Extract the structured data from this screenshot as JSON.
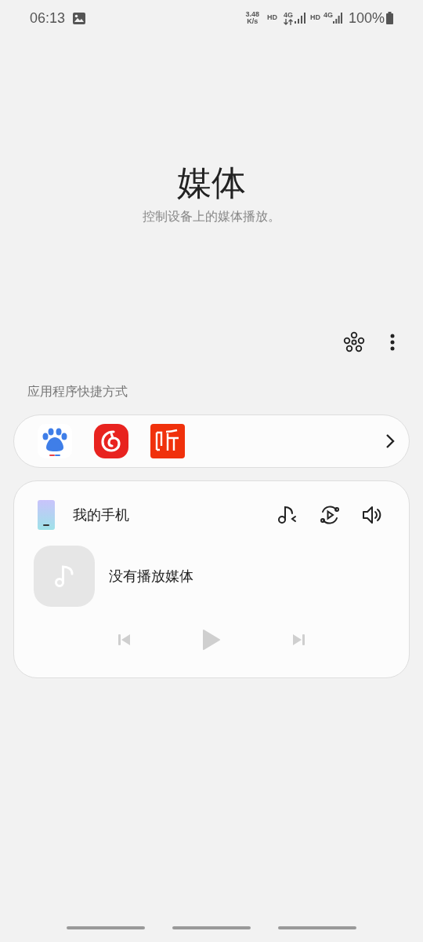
{
  "status_bar": {
    "time": "06:13",
    "speed_value": "3.48",
    "speed_unit": "K/s",
    "sim1_hd": "HD",
    "sim1_network": "4G",
    "sim2_hd": "HD",
    "sim2_network": "4G",
    "battery": "100%"
  },
  "header": {
    "title": "媒体",
    "subtitle": "控制设备上的媒体播放。"
  },
  "section_label": "应用程序快捷方式",
  "shortcuts": [
    {
      "kind": "paw"
    },
    {
      "kind": "swirl"
    },
    {
      "kind": "listen"
    }
  ],
  "player": {
    "device": "我的手机",
    "message": "没有播放媒体",
    "controls": [
      {
        "kind": "previous",
        "disabled": true
      },
      {
        "kind": "play",
        "disabled": true
      },
      {
        "kind": "next",
        "disabled": true
      }
    ]
  }
}
